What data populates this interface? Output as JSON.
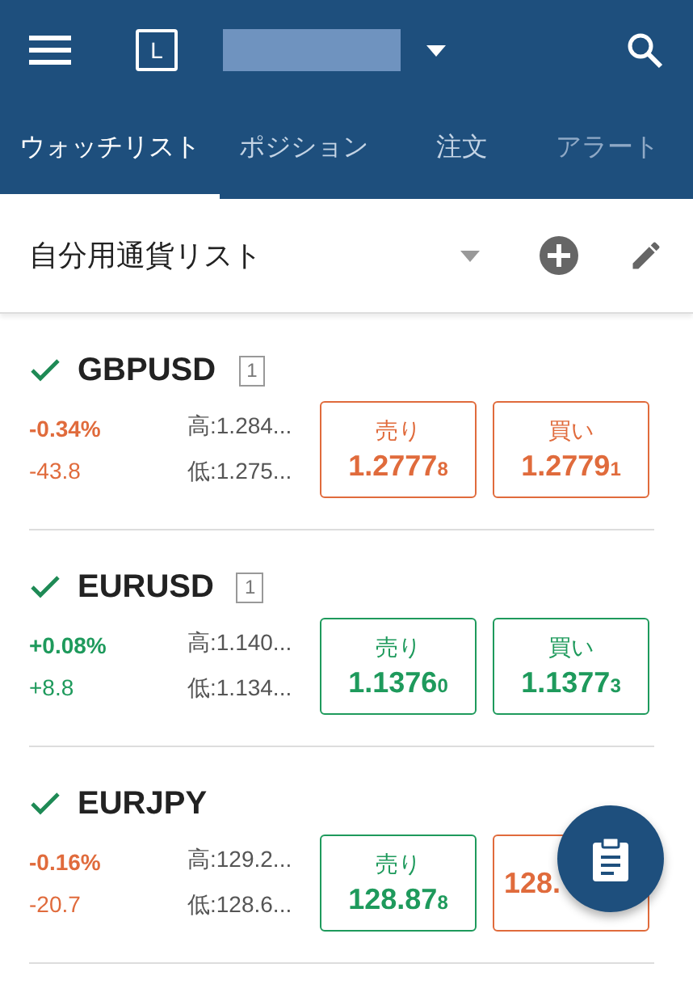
{
  "app_bar": {
    "account_badge": "L"
  },
  "tabs": [
    {
      "label": "ウォッチリスト",
      "selected": true
    },
    {
      "label": "ポジション",
      "selected": false
    },
    {
      "label": "注文",
      "selected": false
    },
    {
      "label": "アラート",
      "selected": false
    }
  ],
  "list_title": "自分用通貨リスト",
  "rows": [
    {
      "symbol": "GBPUSD",
      "checked": true,
      "count": "1",
      "color": "#e06b3c",
      "change_pct": "-0.34%",
      "change": "-43.8",
      "high": "高:1.284...",
      "low": "低:1.275...",
      "sell": {
        "label": "売り",
        "price": "1.2777",
        "price_last": "8",
        "color": "#e06b3c"
      },
      "buy": {
        "label": "買い",
        "price": "1.2779",
        "price_last": "1",
        "color": "#e06b3c"
      }
    },
    {
      "symbol": "EURUSD",
      "checked": true,
      "count": "1",
      "color": "#1e9a5c",
      "change_pct": "+0.08%",
      "change": "+8.8",
      "high": "高:1.140...",
      "low": "低:1.134...",
      "sell": {
        "label": "売り",
        "price": "1.1376",
        "price_last": "0",
        "color": "#1e9a5c"
      },
      "buy": {
        "label": "買い",
        "price": "1.1377",
        "price_last": "3",
        "color": "#1e9a5c"
      }
    },
    {
      "symbol": "EURJPY",
      "checked": true,
      "color": "#e06b3c",
      "change_pct": "-0.16%",
      "change": "-20.7",
      "high": "高:129.2...",
      "low": "低:128.6...",
      "sell": {
        "label": "売り",
        "price": "128.87",
        "price_last": "8",
        "color": "#1e9a5c"
      },
      "buy": {
        "price": "128.",
        "color": "#e06b3c"
      }
    }
  ]
}
